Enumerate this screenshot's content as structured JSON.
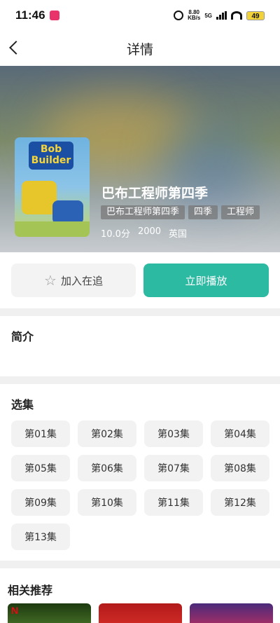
{
  "status_bar": {
    "time": "11:46",
    "net_speed_value": "8.80",
    "net_speed_unit": "KB/s",
    "network": "5G",
    "battery": "49"
  },
  "header": {
    "title": "详情",
    "back_icon": "chevron-left-icon"
  },
  "show": {
    "poster_logo": "Bob Builder",
    "title": "巴布工程师第四季",
    "tags": [
      "巴布工程师第四季",
      "四季",
      "工程师"
    ],
    "score": "10.0分",
    "year": "2000",
    "region": "英国"
  },
  "actions": {
    "follow_label": "加入在追",
    "follow_icon": "star-outline-icon",
    "play_label": "立即播放",
    "play_color": "#2dbaa3"
  },
  "intro": {
    "title": "简介"
  },
  "episodes": {
    "title": "选集",
    "items": [
      "第01集",
      "第02集",
      "第03集",
      "第04集",
      "第05集",
      "第06集",
      "第07集",
      "第08集",
      "第09集",
      "第10集",
      "第11集",
      "第12集",
      "第13集"
    ]
  },
  "related": {
    "title": "相关推荐",
    "badge": "N"
  }
}
